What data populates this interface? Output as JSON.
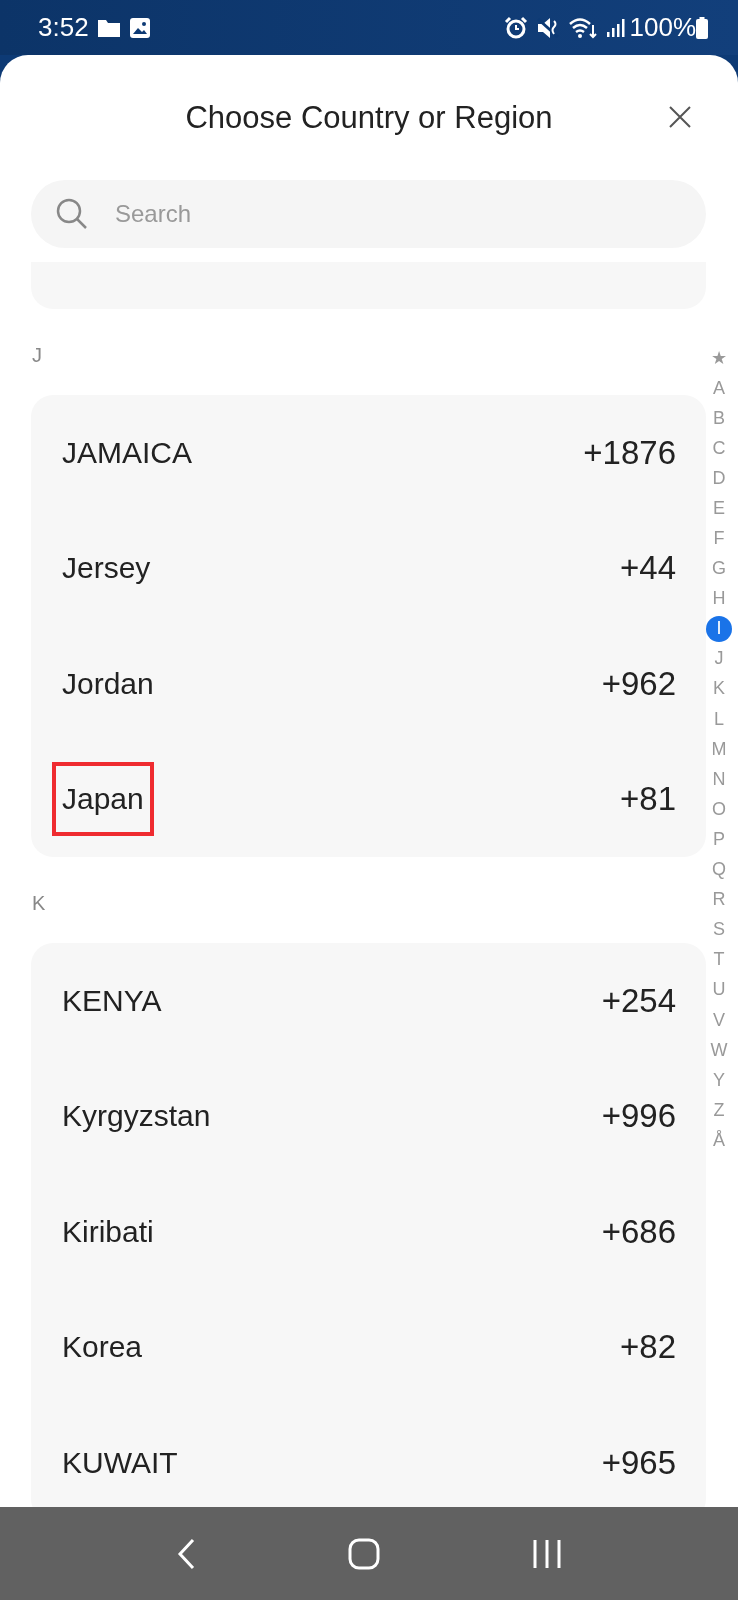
{
  "status_bar": {
    "time": "3:52",
    "battery": "100%"
  },
  "sheet": {
    "title": "Choose Country or Region"
  },
  "search": {
    "placeholder": "Search"
  },
  "sections": [
    {
      "letter": "J",
      "rows": [
        {
          "name": "JAMAICA",
          "code": "+1876",
          "highlighted": false
        },
        {
          "name": "Jersey",
          "code": "+44",
          "highlighted": false
        },
        {
          "name": "Jordan",
          "code": "+962",
          "highlighted": false
        },
        {
          "name": "Japan",
          "code": "+81",
          "highlighted": true
        }
      ]
    },
    {
      "letter": "K",
      "rows": [
        {
          "name": "KENYA",
          "code": "+254",
          "highlighted": false
        },
        {
          "name": "Kyrgyzstan",
          "code": "+996",
          "highlighted": false
        },
        {
          "name": "Kiribati",
          "code": "+686",
          "highlighted": false
        },
        {
          "name": "Korea",
          "code": "+82",
          "highlighted": false
        },
        {
          "name": "KUWAIT",
          "code": "+965",
          "highlighted": false
        }
      ]
    }
  ],
  "index": [
    {
      "label": "★",
      "selected": false
    },
    {
      "label": "A",
      "selected": false
    },
    {
      "label": "B",
      "selected": false
    },
    {
      "label": "C",
      "selected": false
    },
    {
      "label": "D",
      "selected": false
    },
    {
      "label": "E",
      "selected": false
    },
    {
      "label": "F",
      "selected": false
    },
    {
      "label": "G",
      "selected": false
    },
    {
      "label": "H",
      "selected": false
    },
    {
      "label": "I",
      "selected": true
    },
    {
      "label": "J",
      "selected": false
    },
    {
      "label": "K",
      "selected": false
    },
    {
      "label": "L",
      "selected": false
    },
    {
      "label": "M",
      "selected": false
    },
    {
      "label": "N",
      "selected": false
    },
    {
      "label": "O",
      "selected": false
    },
    {
      "label": "P",
      "selected": false
    },
    {
      "label": "Q",
      "selected": false
    },
    {
      "label": "R",
      "selected": false
    },
    {
      "label": "S",
      "selected": false
    },
    {
      "label": "T",
      "selected": false
    },
    {
      "label": "U",
      "selected": false
    },
    {
      "label": "V",
      "selected": false
    },
    {
      "label": "W",
      "selected": false
    },
    {
      "label": "Y",
      "selected": false
    },
    {
      "label": "Z",
      "selected": false
    },
    {
      "label": "Å",
      "selected": false
    }
  ]
}
